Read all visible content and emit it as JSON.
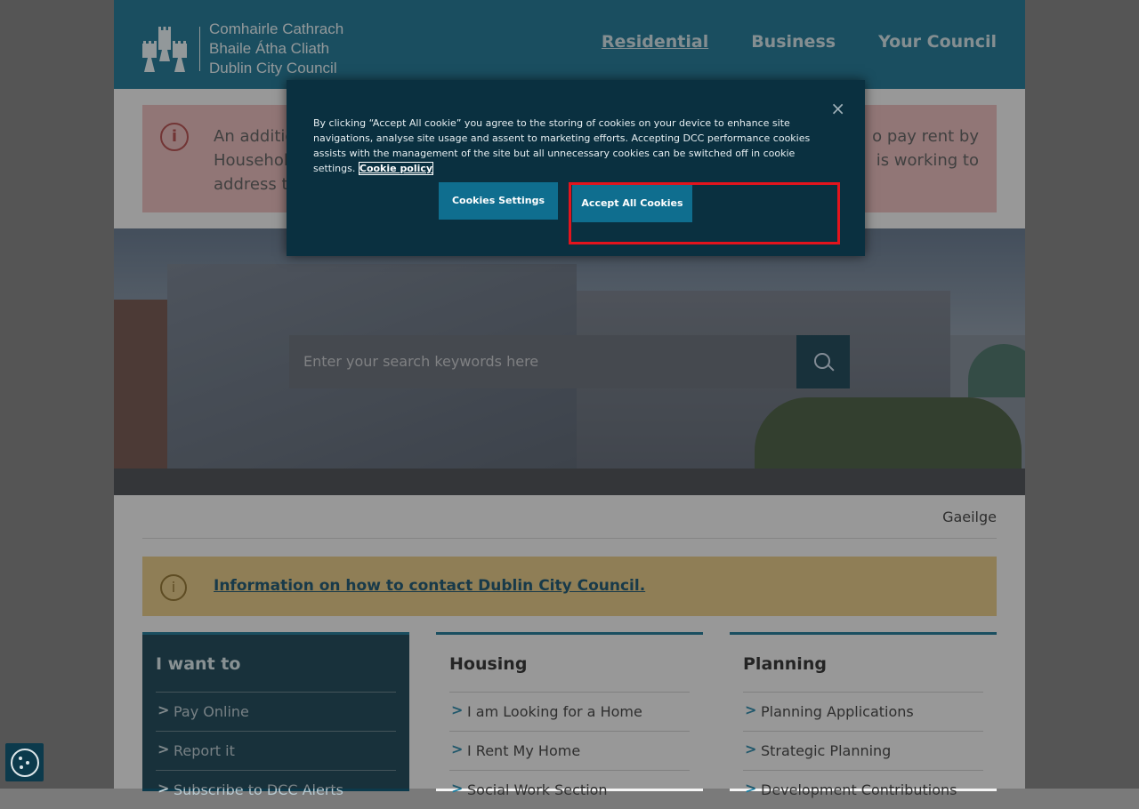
{
  "header": {
    "logo_lines": [
      "Comhairle Cathrach",
      "Bhaile Átha Cliath",
      "Dublin City Council"
    ],
    "nav": [
      {
        "label": "Residential",
        "active": true
      },
      {
        "label": "Business",
        "active": false
      },
      {
        "label": "Your Council",
        "active": false
      }
    ]
  },
  "alert": {
    "icon": "info-circle-icon",
    "line1_start": "An additio",
    "line1_end": "o pay rent by",
    "line2_start": "Househol",
    "line2_end": "is working to",
    "line3_start": "address th"
  },
  "search": {
    "placeholder": "Enter your search keywords here",
    "icon": "search-icon"
  },
  "language_link": "Gaeilge",
  "info": {
    "icon": "info-circle-icon",
    "link": "Information on how to contact Dublin City Council."
  },
  "cards": [
    {
      "title": "I want to",
      "items": [
        "Pay Online",
        "Report it",
        "Subscribe to DCC Alerts"
      ]
    },
    {
      "title": "Housing",
      "items": [
        "I am Looking for a Home",
        "I Rent My Home",
        "Social Work Section"
      ]
    },
    {
      "title": "Planning",
      "items": [
        "Planning Applications",
        "Strategic Planning",
        "Development Contributions"
      ]
    }
  ],
  "cookie_banner": {
    "message": "By clicking “Accept All cookie” you agree to the storing of cookies on your device to enhance site navigations, analyse site usage and assent to marketing efforts. Accepting DCC performance cookies assists with the management of the site but all unnecessary cookies can be switched off in cookie settings.",
    "policy_link": "Cookie policy",
    "settings_button": "Cookies Settings",
    "accept_button": "Accept All Cookies",
    "close_symbol": "×"
  },
  "colors": {
    "brand": "#0f6e8f",
    "alert_bg": "#e7b6b6",
    "info_bg": "#e3c57c",
    "highlight": "#e3141d"
  }
}
